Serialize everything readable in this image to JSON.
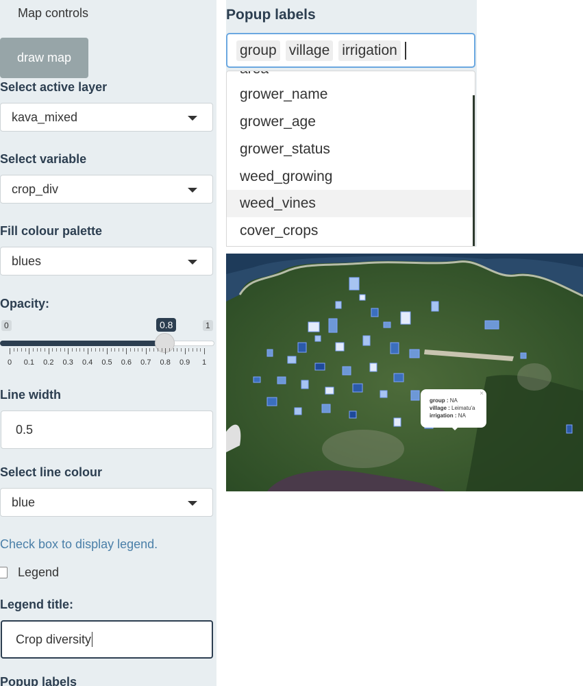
{
  "sidebar": {
    "heading": "Map controls",
    "draw_button": "draw map",
    "active_layer": {
      "label": "Select active layer",
      "value": "kava_mixed"
    },
    "variable": {
      "label": "Select variable",
      "value": "crop_div"
    },
    "palette": {
      "label": "Fill colour palette",
      "value": "blues"
    },
    "opacity": {
      "label": "Opacity:",
      "min": "0",
      "max": "1",
      "value": "0.8",
      "value_fraction": 0.8,
      "tick_labels": [
        "0",
        "0.1",
        "0.2",
        "0.3",
        "0.4",
        "0.5",
        "0.6",
        "0.7",
        "0.8",
        "0.9",
        "1"
      ]
    },
    "line_width": {
      "label": "Line width",
      "value": "0.5"
    },
    "line_colour": {
      "label": "Select line colour",
      "value": "blue"
    },
    "legend_help": "Check box to display legend.",
    "legend_checkbox": {
      "label": "Legend",
      "checked": false
    },
    "legend_title": {
      "label": "Legend title:",
      "value": "Crop diversity"
    },
    "popup_labels_footer": "Popup labels"
  },
  "popup_panel": {
    "label": "Popup labels",
    "tags": [
      "group",
      "village",
      "irrigation"
    ],
    "dropdown_items": [
      "area",
      "grower_name",
      "grower_age",
      "grower_status",
      "weed_growing",
      "weed_vines",
      "cover_crops"
    ],
    "highlighted_item": "weed_vines"
  },
  "map": {
    "popup": {
      "group_key": "group :",
      "group_value": "NA",
      "village_key": "village :",
      "village_value": "Leimatu'a",
      "irrigation_key": "irrigation :",
      "irrigation_value": "NA",
      "close": "×"
    }
  },
  "colors": {
    "sidebar_bg": "#e8eef1",
    "heading_text": "#2c3e50",
    "accent": "#2c3e50",
    "draw_button": "#97a5a8",
    "focus_border": "#6aa7e0",
    "help_text": "#4a7fa8"
  }
}
